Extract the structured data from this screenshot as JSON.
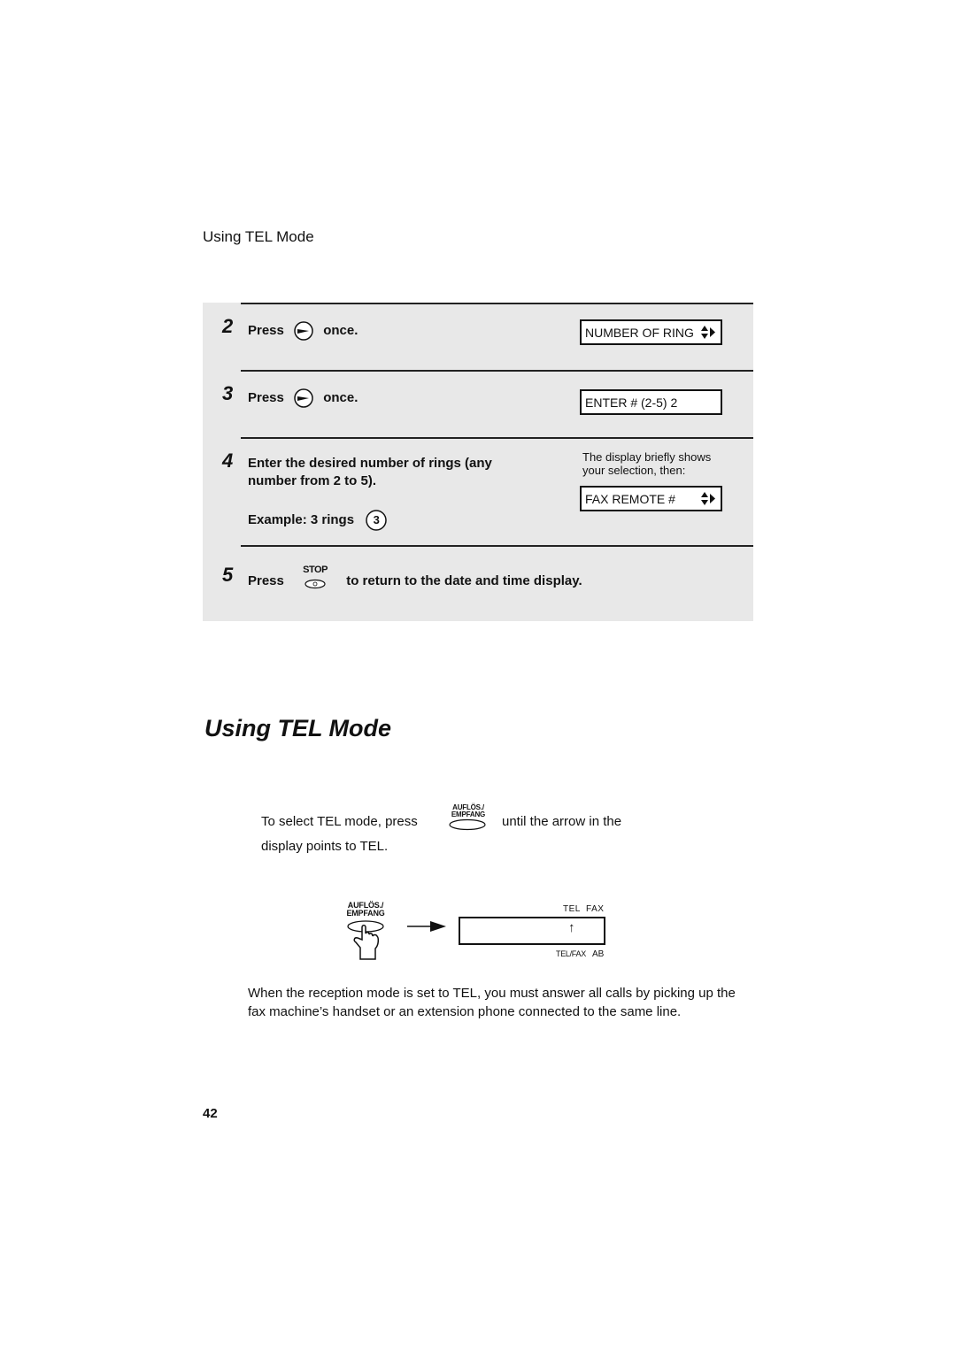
{
  "running_head": "Using TEL Mode",
  "steps": [
    {
      "number": "2",
      "text_before": "Press",
      "button_icon": "right-arrow-button",
      "text_after": "once.",
      "display": {
        "text": "NUMBER OF RING",
        "arrows": "up-down-right"
      }
    },
    {
      "number": "3",
      "text_before": "Press",
      "button_icon": "right-arrow-button",
      "text_after": "once.",
      "display": {
        "text": "ENTER # (2-5) 2"
      }
    },
    {
      "number": "4",
      "line1": "Enter the desired number of rings (any",
      "line2": "number from 2 to 5).",
      "example_label": "Example: 3 rings",
      "example_key": "3",
      "note_line1": "The display briefly shows",
      "note_line2": "your selection, then:",
      "display": {
        "text": "FAX REMOTE #",
        "arrows": "up-down-right"
      }
    },
    {
      "number": "5",
      "text_before": "Press",
      "button_label": "STOP",
      "text_after": "to return to the date and time display."
    }
  ],
  "section_title": "Using TEL Mode",
  "instruction": {
    "before": "To select TEL mode, press",
    "button_line1": "AUFLÖS./",
    "button_line2": "EMPFANG",
    "after": "until the arrow in the",
    "line2": "display points to TEL."
  },
  "illustration": {
    "button_line1": "AUFLÖS./",
    "button_line2": "EMPFANG",
    "top_labels": "TEL  FAX",
    "bottom_label_1": "TEL/FAX",
    "bottom_label_2": "AB",
    "pointer": "↑"
  },
  "paragraph": "When the reception mode is set to TEL, you must answer all calls by picking up the fax machine’s handset or an extension phone connected to the same line.",
  "page_number": "42"
}
